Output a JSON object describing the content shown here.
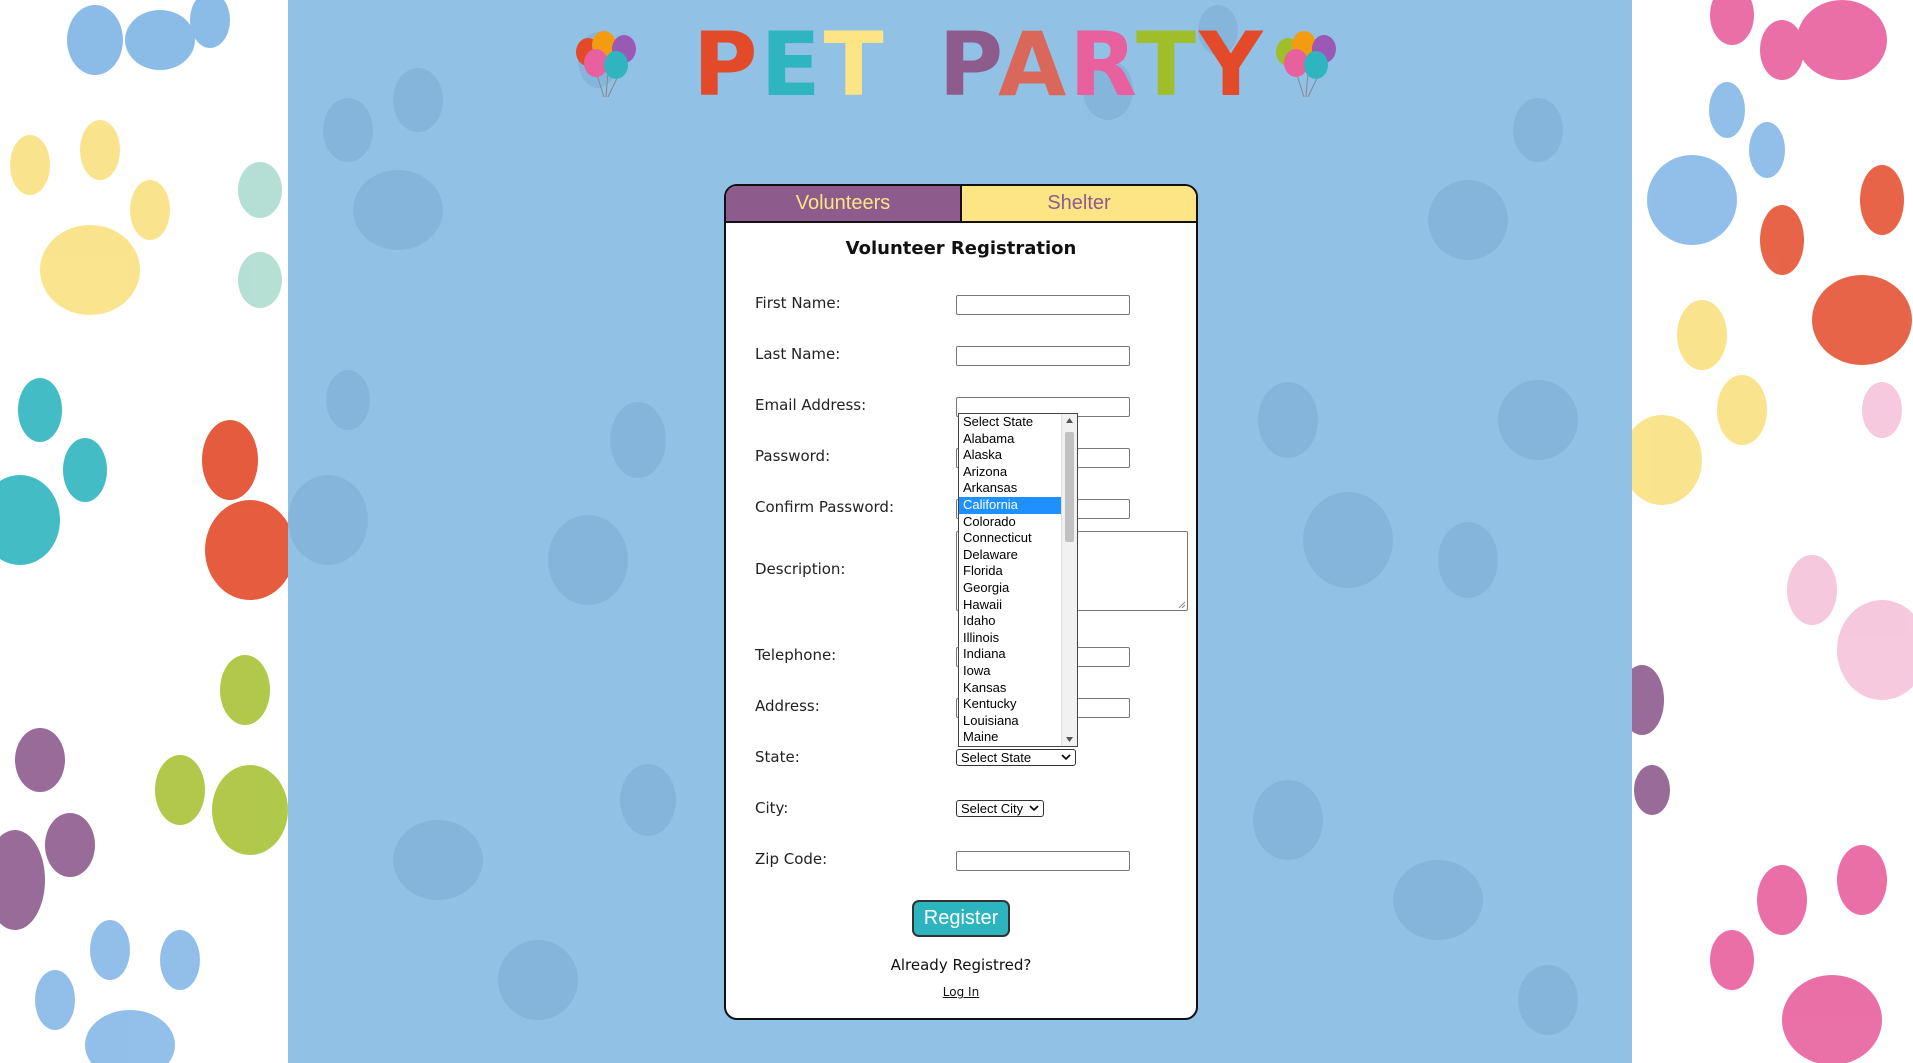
{
  "title": {
    "letters": [
      "P",
      "E",
      "T",
      " ",
      "P",
      "A",
      "R",
      "T",
      "Y"
    ],
    "colors": [
      "#e34a2a",
      "#2fb5c0",
      "#fde484",
      "",
      "#8e5b8d",
      "#d9685a",
      "#e8609e",
      "#9fbe2a",
      "#e34a2a"
    ]
  },
  "tabs": {
    "volunteers": "Volunteers",
    "shelter": "Shelter"
  },
  "form": {
    "title": "Volunteer Registration",
    "first_name": "First Name:",
    "last_name": "Last Name:",
    "email": "Email Address:",
    "password": "Password:",
    "confirm_password": "Confirm Password:",
    "description": "Description:",
    "telephone": "Telephone:",
    "address": "Address:",
    "state": "State:",
    "city": "City:",
    "zip": "Zip Code:",
    "state_select": "Select State",
    "city_select": "Select City",
    "register": "Register",
    "already": "Already Registred?",
    "login": "Log In"
  },
  "state_dropdown": {
    "options": [
      "Select State",
      "Alabama",
      "Alaska",
      "Arizona",
      "Arkansas",
      "California",
      "Colorado",
      "Connecticut",
      "Delaware",
      "Florida",
      "Georgia",
      "Hawaii",
      "Idaho",
      "Illinois",
      "Indiana",
      "Iowa",
      "Kansas",
      "Kentucky",
      "Louisiana",
      "Maine"
    ],
    "highlighted": "California"
  },
  "colors": {
    "background": "#92c1e6",
    "volunteers_tab": "#8e5b8d",
    "shelter_tab": "#fde484",
    "register_button": "#2db5bf",
    "highlight": "#1e90ff"
  }
}
